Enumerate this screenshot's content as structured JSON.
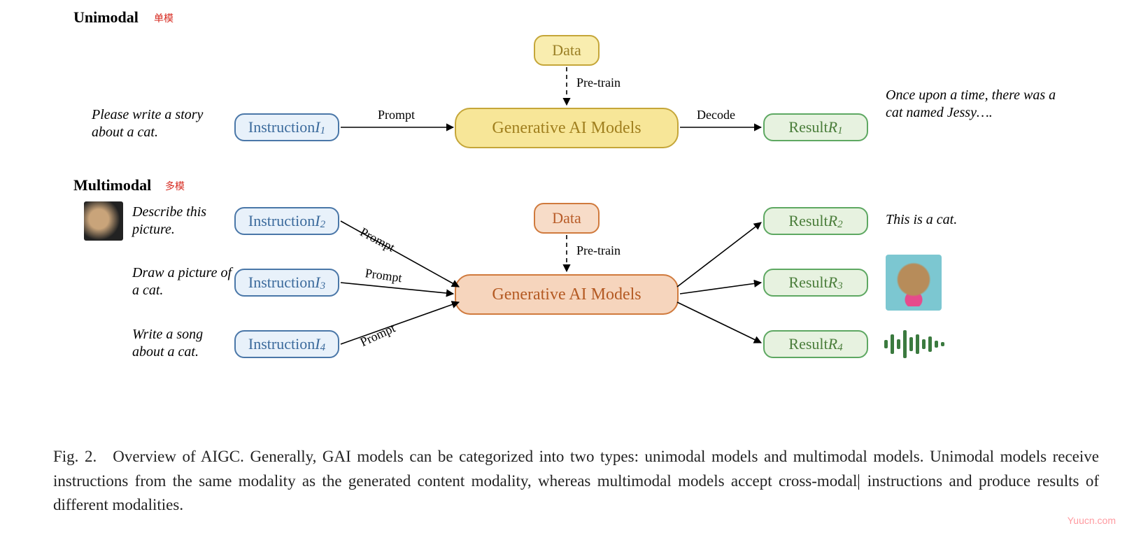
{
  "sections": {
    "unimodal": {
      "title": "Unimodal",
      "annotation": "单模"
    },
    "multimodal": {
      "title": "Multimodal",
      "annotation": "多模"
    }
  },
  "unimodal": {
    "prompt_text": "Please write a story about a cat.",
    "instruction": {
      "label": "Instruction ",
      "var": "I",
      "sub": "1"
    },
    "data_label": "Data",
    "pretrain_label": "Pre-train",
    "model_label": "Generative AI Models",
    "prompt_edge": "Prompt",
    "decode_edge": "Decode",
    "result": {
      "label": "Result ",
      "var": "R",
      "sub": "1"
    },
    "output_text": "Once upon a time, there was a cat named Jessy…."
  },
  "multimodal": {
    "inputs": [
      {
        "desc": "Describe this picture.",
        "instruction": {
          "label": "Instruction ",
          "var": "I",
          "sub": "2"
        },
        "has_image": true
      },
      {
        "desc": "Draw a picture of a cat.",
        "instruction": {
          "label": "Instruction ",
          "var": "I",
          "sub": "3"
        },
        "has_image": false
      },
      {
        "desc": "Write a song about a cat.",
        "instruction": {
          "label": "Instruction ",
          "var": "I",
          "sub": "4"
        },
        "has_image": false
      }
    ],
    "data_label": "Data",
    "pretrain_label": "Pre-train",
    "model_label": "Generative AI Models",
    "prompt_edge": "Prompt",
    "results": [
      {
        "label": "Result ",
        "var": "R",
        "sub": "2",
        "output_kind": "text",
        "output_text": "This is a cat."
      },
      {
        "label": "Result ",
        "var": "R",
        "sub": "3",
        "output_kind": "image"
      },
      {
        "label": "Result ",
        "var": "R",
        "sub": "4",
        "output_kind": "audio"
      }
    ]
  },
  "caption": {
    "prefix": "Fig. 2. Overview of AIGC. Generally, GAI models can be categorized into two types: unimodal models and multimodal models. Unimodal models receive instructions from the same modality as the generated content modality, whereas multimodal models accept cross-modal",
    "suffix": " instructions and produce results of different modalities."
  },
  "watermark": "Yuucn.com"
}
